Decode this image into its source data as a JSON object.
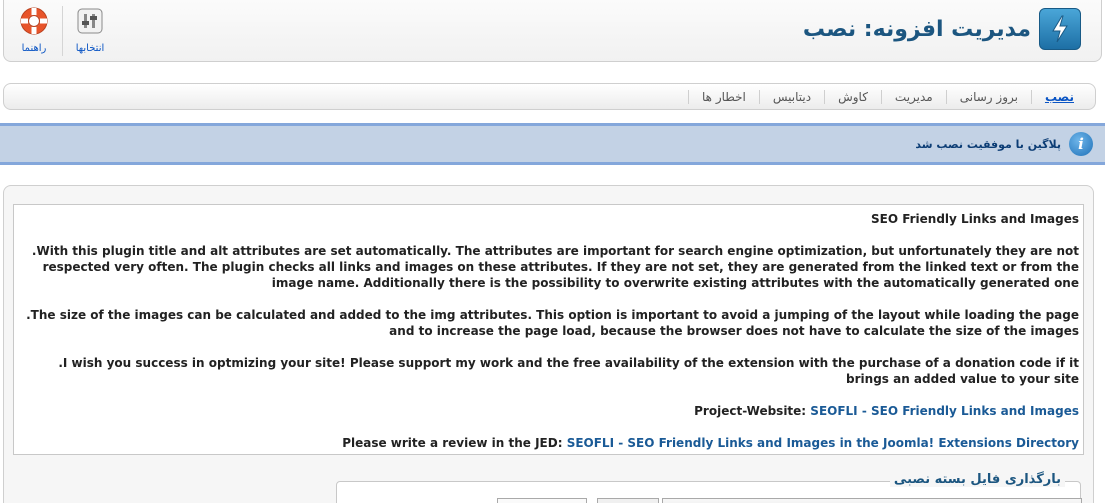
{
  "header": {
    "title": "مدیریت افزونه: نصب",
    "toolbar": {
      "help_label": "راهنما",
      "options_label": "انتخابها"
    }
  },
  "submenu": {
    "tabs": [
      {
        "label": "نصب",
        "active": true
      },
      {
        "label": "بروز رسانی",
        "active": false
      },
      {
        "label": "مدیریت",
        "active": false
      },
      {
        "label": "کاوش",
        "active": false
      },
      {
        "label": "دیتابیس",
        "active": false
      },
      {
        "label": "اخطار ها",
        "active": false
      }
    ]
  },
  "message": {
    "text": "پلاگین با موفقیت نصب شد",
    "icon": "info-icon"
  },
  "description": {
    "title": "SEO Friendly Links and Images",
    "paragraph1": ".With this plugin title and alt attributes are set automatically. The attributes are important for search engine optimization, but unfortunately they are not respected very often. The plugin checks all links and images on these attributes. If they are not set, they are generated from the linked text or from the image name. Additionally there is the possibility to overwrite existing attributes with the automatically generated one",
    "paragraph2": ".The size of the images can be calculated and added to the img attributes. This option is important to avoid a jumping of the layout while loading the page and to increase the page load, because the browser does not have to calculate the size of the images",
    "paragraph3": ".I wish you success in optmizing your site! Please support my work and the free availability of the extension with the purchase of a donation code if it brings an added value to your site",
    "project_label": "Project-Website:",
    "project_link": "SEOFLI - SEO Friendly Links and Images",
    "review_label": "Please write a review in the JED:",
    "review_link": "SEOFLI - SEO Friendly Links and Images in the Joomla! Extensions Directory"
  },
  "upload": {
    "legend": "بارگذاری فایل بسته نصبی"
  },
  "colors": {
    "title_blue": "#1c5680",
    "link_blue": "#1a5a96",
    "message_bg": "#c3d2e5",
    "message_border": "#84a7db"
  }
}
